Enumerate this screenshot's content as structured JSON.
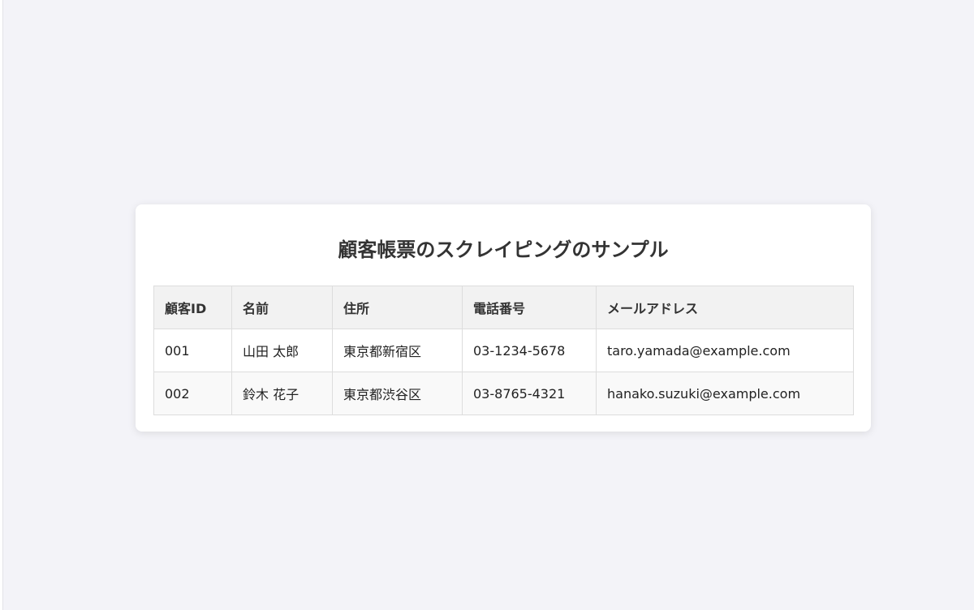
{
  "page": {
    "title": "顧客帳票のスクレイピングのサンプル"
  },
  "table": {
    "headers": [
      "顧客ID",
      "名前",
      "住所",
      "電話番号",
      "メールアドレス"
    ],
    "rows": [
      [
        "001",
        "山田 太郎",
        "東京都新宿区",
        "03-1234-5678",
        "taro.yamada@example.com"
      ],
      [
        "002",
        "鈴木 花子",
        "東京都渋谷区",
        "03-8765-4321",
        "hanako.suzuki@example.com"
      ]
    ]
  },
  "colors": {
    "background": "#f3f3f8",
    "card": "#ffffff",
    "header_bg": "#f2f2f2",
    "border": "#dddddd",
    "alt_row_bg": "#f9f9f9"
  }
}
